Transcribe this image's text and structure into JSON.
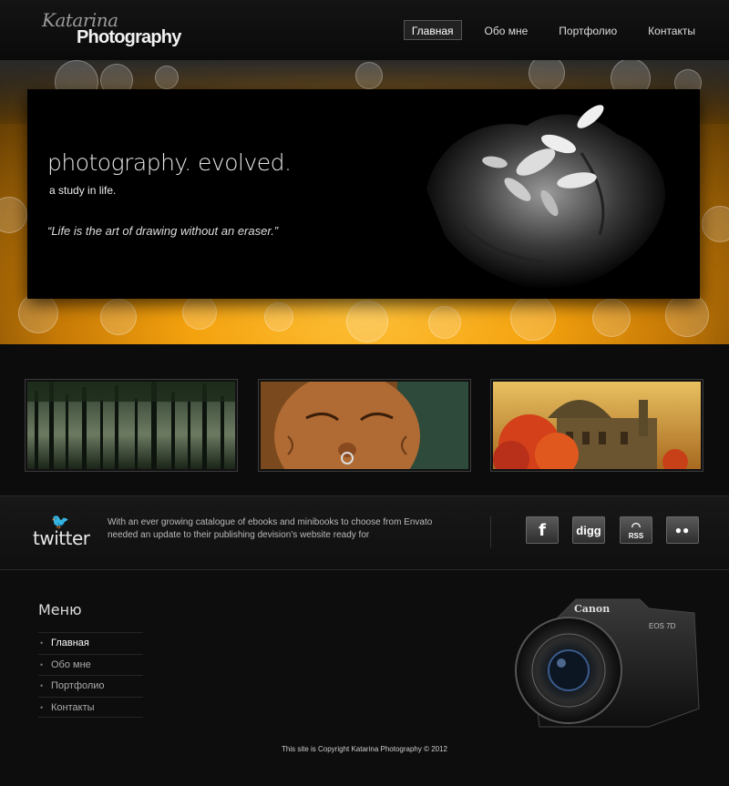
{
  "header": {
    "logo_script": "Katarina",
    "logo_main": "Photography",
    "nav": [
      "Главная",
      "Обо мне",
      "Портфолио",
      "Контакты"
    ],
    "active_nav": "Главная"
  },
  "hero": {
    "title": "photography. evolved.",
    "subtitle": "a study in life.",
    "quote": "“Life is the art of drawing without an eraser.”"
  },
  "thumbnails": [
    {
      "subject": "forest"
    },
    {
      "subject": "elderly woman portrait"
    },
    {
      "subject": "building with autumn tree"
    }
  ],
  "social": {
    "twitter_label": "twitter",
    "tweet": "With an ever growing catalogue of ebooks and minibooks to choose from Envato needed an update to their publishing devision’s website ready for",
    "icons": [
      {
        "name": "facebook-icon",
        "glyph": "f"
      },
      {
        "name": "digg-icon",
        "glyph": "digg"
      },
      {
        "name": "rss-icon",
        "glyph": "RSS"
      },
      {
        "name": "flickr-icon",
        "glyph": "●●"
      }
    ]
  },
  "footer": {
    "menu_title": "Меню",
    "menu_items": [
      "Главная",
      "Обо мне",
      "Портфолио",
      "Контакты"
    ],
    "copyright": "This site is Copyright Katarina Photography © 2012"
  },
  "colors": {
    "accent": "#f4a20e",
    "background": "#0c0c0c"
  }
}
